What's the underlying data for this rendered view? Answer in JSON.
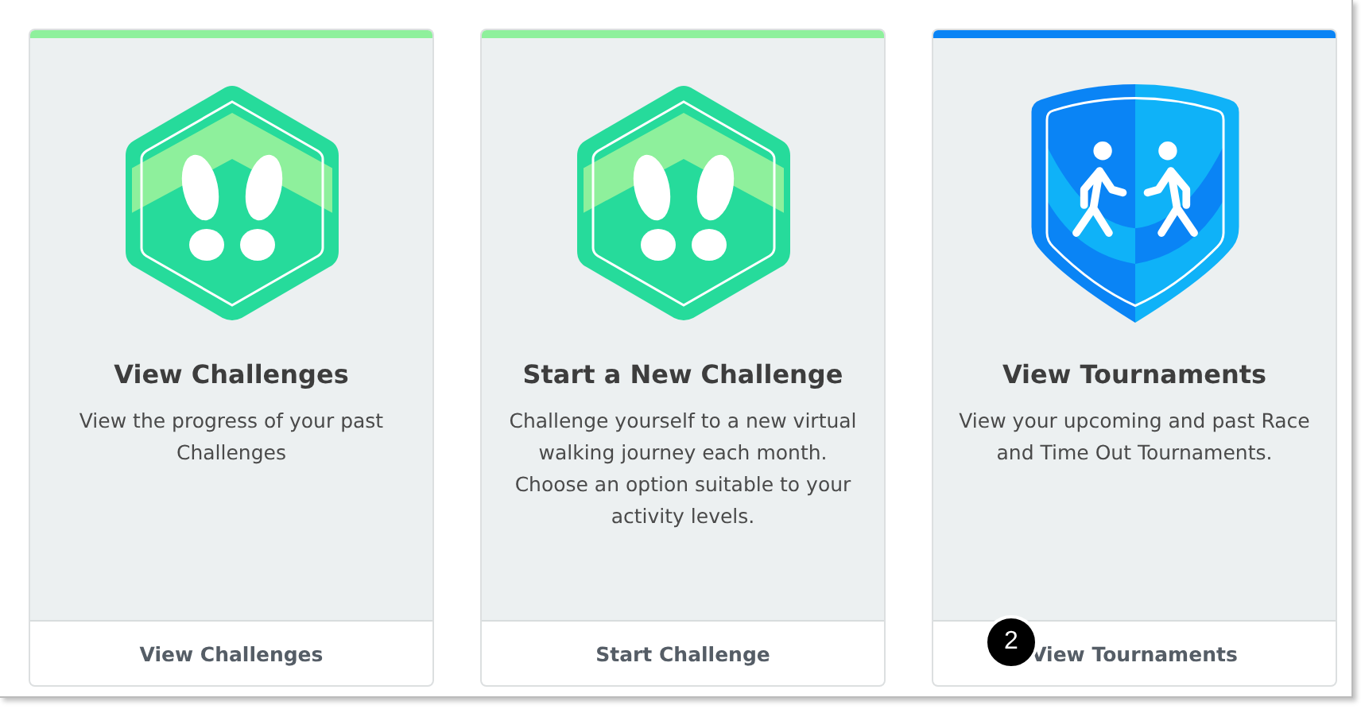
{
  "cards": [
    {
      "kind": "footprints",
      "color": "#8ef09c",
      "title": "View Challenges",
      "description": "View the progress of your past Challenges",
      "action": "View Challenges"
    },
    {
      "kind": "footprints",
      "color": "#8ef09c",
      "title": "Start a New Challenge",
      "description": "Challenge yourself to a new virtual walking journey each month. Choose an option suitable to your activity levels.",
      "action": "Start Challenge"
    },
    {
      "kind": "shield",
      "color": "#0a84f5",
      "title": "View Tournaments",
      "description": "View your upcoming and past Race and Time Out Tournaments.",
      "action": "View Tournaments",
      "annotation": "2"
    }
  ]
}
